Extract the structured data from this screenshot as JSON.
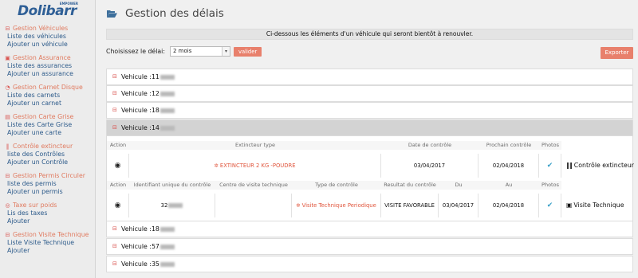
{
  "logo": {
    "name": "Dolibarr",
    "sub": "EMPOWER"
  },
  "sidebar": {
    "groups": [
      {
        "title": "Gestion Véhicules",
        "icon": "car-icon",
        "links": [
          "Liste des véhicules",
          "Ajouter un véhicule"
        ]
      },
      {
        "title": "Gestion Assurance",
        "icon": "briefcase-icon",
        "links": [
          "Liste des assurances",
          "Ajouter un assurance"
        ]
      },
      {
        "title": "Gestion Carnet Disque",
        "icon": "gauge-icon",
        "links": [
          "Liste des carnets",
          "Ajouter un carnet"
        ]
      },
      {
        "title": "Gestion Carte Grise",
        "icon": "card-icon",
        "links": [
          "Liste des Carte Grise",
          "Ajouter une carte"
        ]
      },
      {
        "title": "Contrôle extincteur",
        "icon": "extinguisher-icon",
        "links": [
          "liste des Contrôles",
          "Ajouter un Contrôle"
        ]
      },
      {
        "title": "Gestion Permis Circuler",
        "icon": "car-icon",
        "links": [
          "liste des permis",
          "Ajouter un permis"
        ]
      },
      {
        "title": "Taxe sur poids",
        "icon": "globe-icon",
        "links": [
          "Lis des taxes",
          "Ajouter"
        ]
      },
      {
        "title": "Gestion Visite Technique",
        "icon": "car-icon",
        "links": [
          "Liste Visite Technique",
          "Ajouter"
        ]
      }
    ]
  },
  "page": {
    "title": "Gestion des délais",
    "info": "Ci-dessous les éléments d'un véhicule qui seront bientôt à renouvler.",
    "filter_label": "Choisissez le délai:",
    "filter_value": "2 mois",
    "valider_label": "valider",
    "export_label": "Exporter"
  },
  "vehicles": {
    "prefix": "Vehicule : ",
    "rows": [
      "11",
      "12",
      "18",
      "14",
      "18",
      "57",
      "35"
    ]
  },
  "extincteur": {
    "headers": [
      "Action",
      "Extincteur type",
      "Date de contrôle",
      "Prochain contrôle",
      "Photos"
    ],
    "row": {
      "type": "EXTINCTEUR 2 KG -POUDRE",
      "date": "03/04/2017",
      "next": "02/04/2018",
      "label": "Contrôle extincteur"
    }
  },
  "visite": {
    "headers": [
      "Action",
      "Identifiant unique du contrôle",
      "Centre de visite technique",
      "Type de contrôle",
      "Resultat du contrôle",
      "Du",
      "Au",
      "Photos"
    ],
    "row": {
      "id": "32",
      "centre": "",
      "type": "Visite Technique Periodique",
      "result": "VISITE FAVORABLE",
      "du": "03/04/2017",
      "au": "02/04/2018",
      "label": "Visite Technique"
    }
  },
  "colors": {
    "accent": "#e8806c",
    "link": "#2c5a8a",
    "logo": "#2f5f96"
  }
}
